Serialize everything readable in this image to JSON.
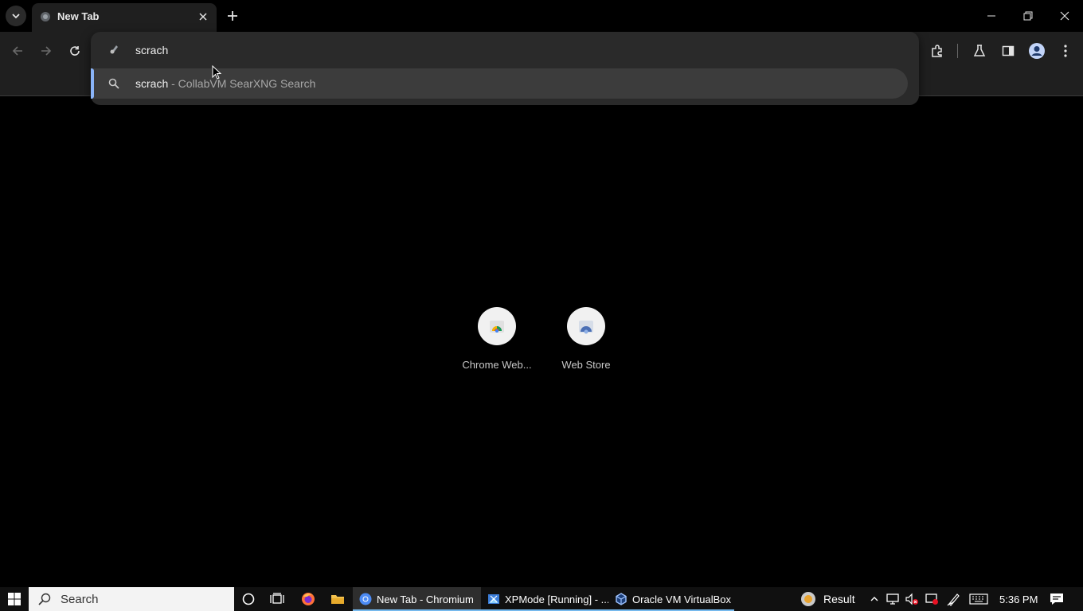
{
  "browser": {
    "tab": {
      "title": "New Tab"
    },
    "omnibox": {
      "input_value": "scrach",
      "suggestion": {
        "query": "scrach",
        "description": " - CollabVM SearXNG Search"
      }
    }
  },
  "shortcuts": [
    {
      "label": "Chrome Web..."
    },
    {
      "label": "Web Store"
    }
  ],
  "taskbar": {
    "search_placeholder": "Search",
    "apps": [
      {
        "label": "New Tab - Chromium"
      },
      {
        "label": "XPMode [Running] - ..."
      },
      {
        "label": "Oracle VM VirtualBox ..."
      }
    ],
    "tray_result_label": "Result",
    "clock": "5:36 PM"
  },
  "colors": {
    "accent": "#8ab4f8",
    "toolbar": "#1f1f1f",
    "taskbar": "#101010"
  }
}
